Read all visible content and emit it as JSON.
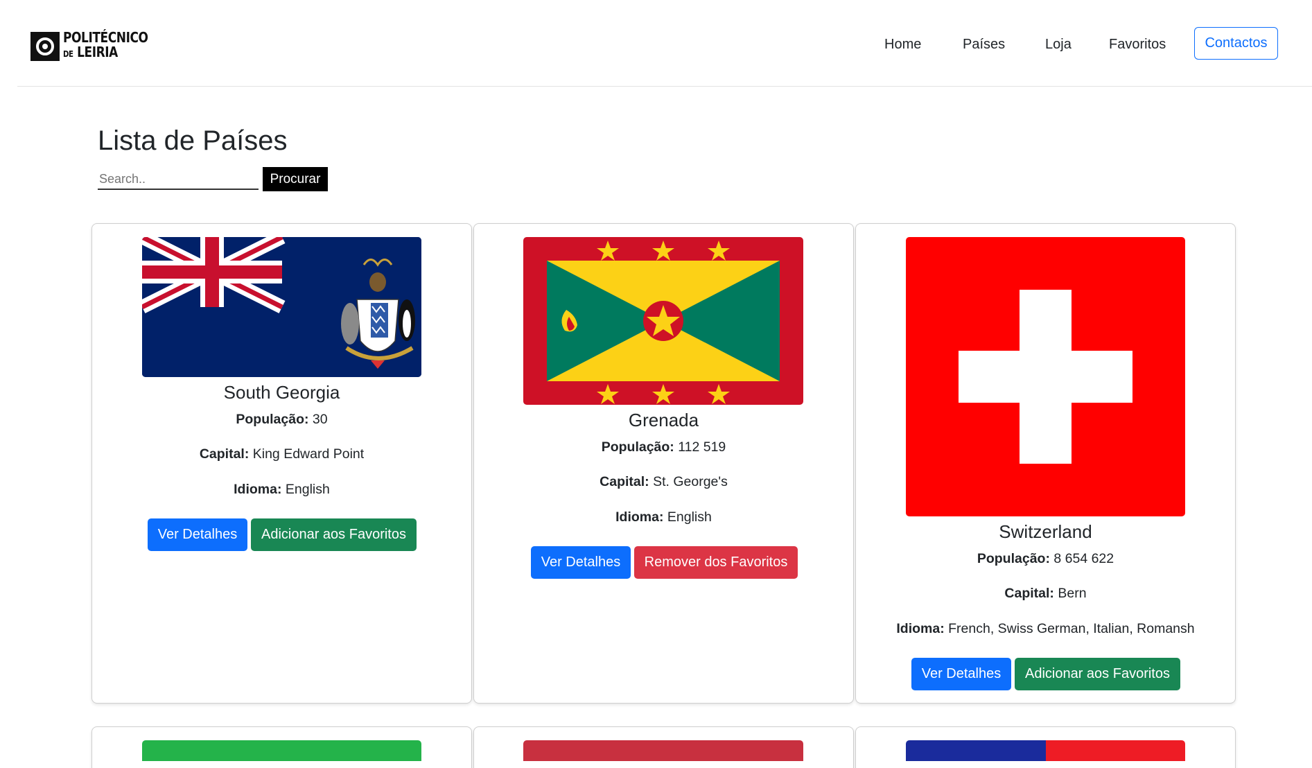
{
  "nav": {
    "logo_line1": "POLITÉCNICO",
    "logo_de": "DE",
    "logo_line2": "LEIRIA",
    "links": [
      "Home",
      "Países",
      "Loja",
      "Favoritos"
    ],
    "contact": "Contactos"
  },
  "page": {
    "title": "Lista de Países",
    "search_placeholder": "Search..",
    "search_button": "Procurar"
  },
  "labels": {
    "population": "População:",
    "capital": "Capital:",
    "language": "Idioma:",
    "details": "Ver Detalhes",
    "add_fav": "Adicionar aos Favoritos",
    "remove_fav": "Remover dos Favoritos"
  },
  "countries": [
    {
      "name": "South Georgia",
      "population": "30",
      "capital": "King Edward Point",
      "language": "English",
      "favorite_action": "Adicionar aos Favoritos",
      "flag": "south-georgia-flag"
    },
    {
      "name": "Grenada",
      "population": "112 519",
      "capital": "St. George's",
      "language": "English",
      "favorite_action": "Remover dos Favoritos",
      "flag": "grenada-flag"
    },
    {
      "name": "Switzerland",
      "population": "8 654 622",
      "capital": "Bern",
      "language": "French, Swiss German, Italian, Romansh",
      "favorite_action": "Adicionar aos Favoritos",
      "flag": "switzerland-flag"
    }
  ],
  "colors": {
    "primary": "#0d6efd",
    "success": "#198754",
    "danger": "#dc3545"
  }
}
